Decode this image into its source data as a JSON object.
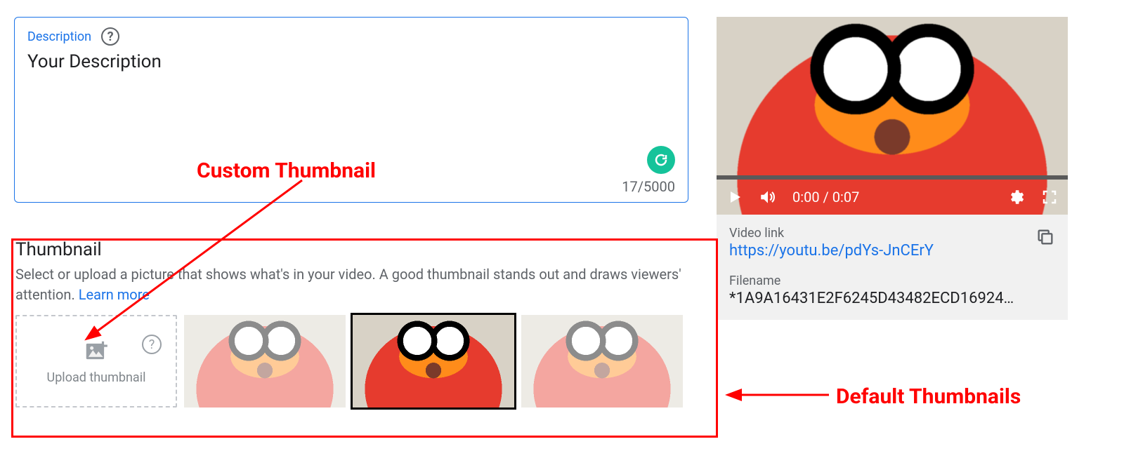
{
  "description": {
    "label": "Description",
    "value": "Your Description",
    "char_count": "17/5000"
  },
  "annotations": {
    "custom_thumbnail": "Custom Thumbnail",
    "default_thumbnails": "Default Thumbnails"
  },
  "thumbnail": {
    "title": "Thumbnail",
    "help_text": "Select or upload a picture that shows what's in your video. A good thumbnail stands out and draws viewers' attention. ",
    "learn_more": "Learn more",
    "upload_label": "Upload thumbnail"
  },
  "video": {
    "time": "0:00 / 0:07",
    "link_label": "Video link",
    "link": "https://youtu.be/pdYs-JnCErY",
    "filename_label": "Filename",
    "filename": "*1A9A16431E2F6245D43482ECD16924…"
  }
}
